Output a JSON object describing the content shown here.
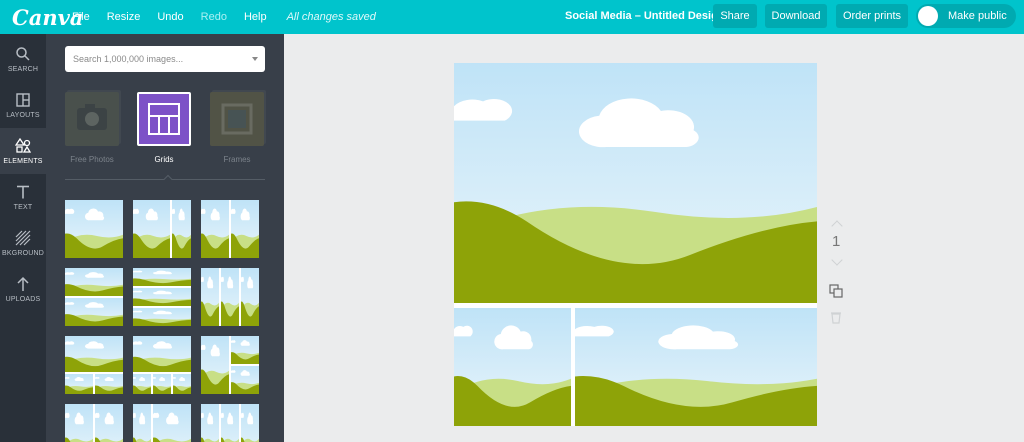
{
  "app": {
    "logo": "Canva",
    "menu": [
      {
        "label": "File"
      },
      {
        "label": "Resize"
      },
      {
        "label": "Undo"
      },
      {
        "label": "Redo"
      },
      {
        "label": "Help"
      }
    ],
    "status": "All changes saved",
    "document_title": "Social Media – Untitled Design",
    "buttons": {
      "share": "Share",
      "download": "Download",
      "order_prints": "Order prints",
      "make_public": "Make public"
    }
  },
  "rail": [
    {
      "label": "SEARCH",
      "icon": "search-icon"
    },
    {
      "label": "LAYOUTS",
      "icon": "layouts-icon"
    },
    {
      "label": "ELEMENTS",
      "icon": "elements-icon",
      "active": true
    },
    {
      "label": "TEXT",
      "icon": "text-icon"
    },
    {
      "label": "BKGROUND",
      "icon": "background-icon"
    },
    {
      "label": "UPLOADS",
      "icon": "upload-icon"
    }
  ],
  "panel": {
    "search_placeholder": "Search 1,000,000 images...",
    "categories": [
      {
        "label": "Free Photos",
        "icon": "camera-icon"
      },
      {
        "label": "Grids",
        "icon": "grid-icon",
        "active": true
      },
      {
        "label": "Frames",
        "icon": "frame-icon"
      }
    ]
  },
  "canvas": {
    "page_number": "1"
  },
  "colors": {
    "brand": "#00c4cc",
    "button": "#00aab1",
    "rail": "#293039",
    "panel": "#383f49",
    "grids_active": "#7d52c7",
    "sky": "#d3ebfa",
    "hill_light": "#c8df86",
    "hill_dark": "#8ea308"
  }
}
